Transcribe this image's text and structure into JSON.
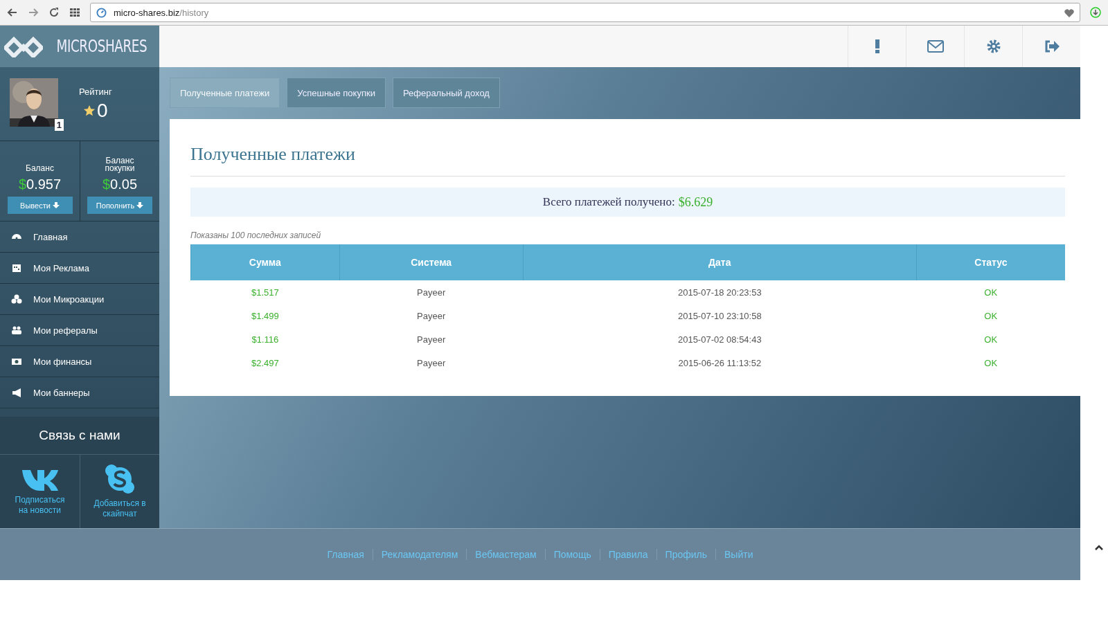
{
  "browser": {
    "url_host": "micro-shares.biz",
    "url_path": "/history"
  },
  "logo": {
    "text": "MICROSHARES"
  },
  "profile": {
    "rating_label": "Рейтинг",
    "rating": "0",
    "level": "1"
  },
  "balances": [
    {
      "label": "Баланс",
      "currency": "$",
      "amount": "0.957",
      "button": "Вывести"
    },
    {
      "label": "Баланс покупки",
      "currency": "$",
      "amount": "0.05",
      "button": "Пополнить"
    }
  ],
  "sidebar": {
    "items": [
      {
        "label": "Главная",
        "kind": "dashboard"
      },
      {
        "label": "Моя Реклама",
        "kind": "calendar"
      },
      {
        "label": "Мои Микроакции",
        "kind": "cubes"
      },
      {
        "label": "Мои рефералы",
        "kind": "users"
      },
      {
        "label": "Мои финансы",
        "kind": "money"
      },
      {
        "label": "Мои баннеры",
        "kind": "bullhorn"
      }
    ]
  },
  "contact": {
    "title": "Связь с нами",
    "links": [
      {
        "kind": "vk",
        "label": "Подписаться на новости"
      },
      {
        "kind": "skype",
        "label": "Добавиться в скайпчат"
      }
    ]
  },
  "tabs": [
    {
      "label": "Полученные платежи",
      "selected": true
    },
    {
      "label": "Успешные покупки",
      "selected": false
    },
    {
      "label": "Реферальный доход",
      "selected": false
    }
  ],
  "panel": {
    "title": "Полученные платежи",
    "total_label": "Всего платежей получено:",
    "total": "$6.629",
    "note": "Показаны 100 последних записей"
  },
  "table": {
    "columns": [
      "Сумма",
      "Система",
      "Дата",
      "Статус"
    ],
    "rows": [
      [
        "$1.517",
        "Payeer",
        "2015-07-18 20:23:53",
        "OK"
      ],
      [
        "$1.499",
        "Payeer",
        "2015-07-10 23:10:58",
        "OK"
      ],
      [
        "$1.116",
        "Payeer",
        "2015-07-02 08:54:43",
        "OK"
      ],
      [
        "$2.497",
        "Payeer",
        "2015-06-26 11:13:52",
        "OK"
      ]
    ]
  },
  "footer": {
    "links": [
      "Главная",
      "Рекламодателям",
      "Вебмастерам",
      "Помощь",
      "Правила",
      "Профиль",
      "Выйти"
    ]
  }
}
